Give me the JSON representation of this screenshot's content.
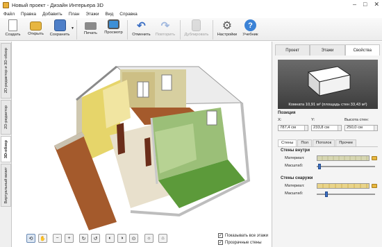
{
  "window": {
    "title": "Новый проект - Дизайн Интерьера 3D",
    "minimize": "–",
    "maximize": "□",
    "close": "✕"
  },
  "menu": [
    "Файл",
    "Правка",
    "Добавить",
    "План",
    "Этажи",
    "Вид",
    "Справка"
  ],
  "toolbar": {
    "create": "Создать",
    "open": "Открыть",
    "save": "Сохранить",
    "print": "Печать",
    "preview": "Просмотр",
    "undo": "Отменить",
    "redo": "Повторить",
    "duplicate": "Дублировать",
    "settings": "Настройки",
    "tutorial": "Учебник"
  },
  "left_tabs": [
    "2D-редактор и 3D-обзор",
    "2D-редактор",
    "3D-обзор",
    "Виртуальный визит"
  ],
  "view_controls": {
    "show_all_floors": "Показывать все этажи",
    "transparent_walls": "Прозрачные стены"
  },
  "view_buttons_icons": [
    "rotate-icon",
    "hand-icon",
    "zoom-out-icon",
    "zoom-in-icon",
    "orbit-icon",
    "orbit-alt-icon",
    "eye-level-icon",
    "eye-down-icon",
    "tilt-icon",
    "lamp-icon",
    "home-icon"
  ],
  "panel": {
    "tabs": [
      "Проект",
      "Этажи",
      "Свойства"
    ],
    "room_caption": "Комната 10,91 м² (площадь стен 33,43 м²)",
    "position_title": "Позиция",
    "x_label": "X:",
    "x_value": "787,4 см",
    "y_label": "Y:",
    "y_value": "233,8 см",
    "height_label": "Высота стен:",
    "height_value": "250,0 см",
    "subtabs": [
      "Стены",
      "Пол",
      "Потолок",
      "Прочее"
    ],
    "inner_title": "Стены внутри",
    "inner_material": "Материал:",
    "inner_scale": "Масштаб:",
    "outer_title": "Стены снаружи",
    "outer_material": "Материал:",
    "outer_scale": "Масштаб:"
  },
  "colors": {
    "accent": "#3b6fc4",
    "wall_green": "#9bbf78",
    "floor_wood": "#a45a2c"
  }
}
